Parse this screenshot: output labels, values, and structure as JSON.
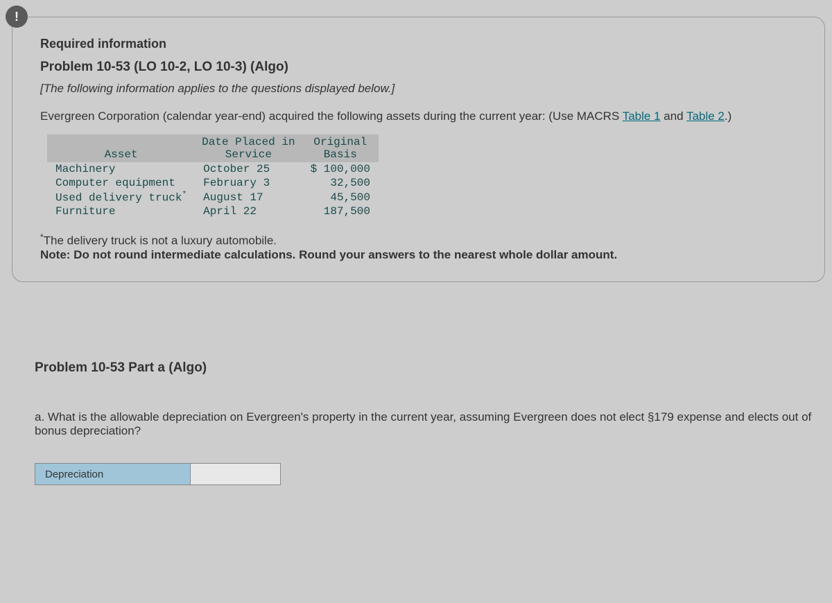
{
  "panel": {
    "required_info": "Required information",
    "problem_title": "Problem 10-53 (LO 10-2, LO 10-3) (Algo)",
    "instruction": "[The following information applies to the questions displayed below.]",
    "intro_prefix": "Evergreen Corporation (calendar year-end) acquired the following assets during the current year: (Use MACRS ",
    "link1": "Table 1",
    "intro_and": " and ",
    "link2": "Table 2",
    "intro_suffix": ".)",
    "table": {
      "headers": {
        "asset": "Asset",
        "date": "Date Placed in\nService",
        "basis": "Original\nBasis"
      },
      "rows": [
        {
          "asset": "Machinery",
          "date": "October 25",
          "basis": "$ 100,000"
        },
        {
          "asset": "Computer equipment",
          "date": "February 3",
          "basis": "32,500"
        },
        {
          "asset": "Used delivery truck",
          "asterisk": "*",
          "date": "August 17",
          "basis": "45,500"
        },
        {
          "asset": "Furniture",
          "date": "April 22",
          "basis": "187,500"
        }
      ]
    },
    "footnote_marker": "*",
    "footnote_text": "The delivery truck is not a luxury automobile.",
    "note_label": "Note: ",
    "note_text": "Do not round intermediate calculations. Round your answers to the nearest whole dollar amount."
  },
  "section2": {
    "part_heading": "Problem 10-53 Part a (Algo)",
    "question": "a. What is the allowable depreciation on Evergreen's property in the current year, assuming Evergreen does not elect §179 expense and elects out of bonus depreciation?",
    "answer_label": "Depreciation",
    "answer_value": ""
  }
}
